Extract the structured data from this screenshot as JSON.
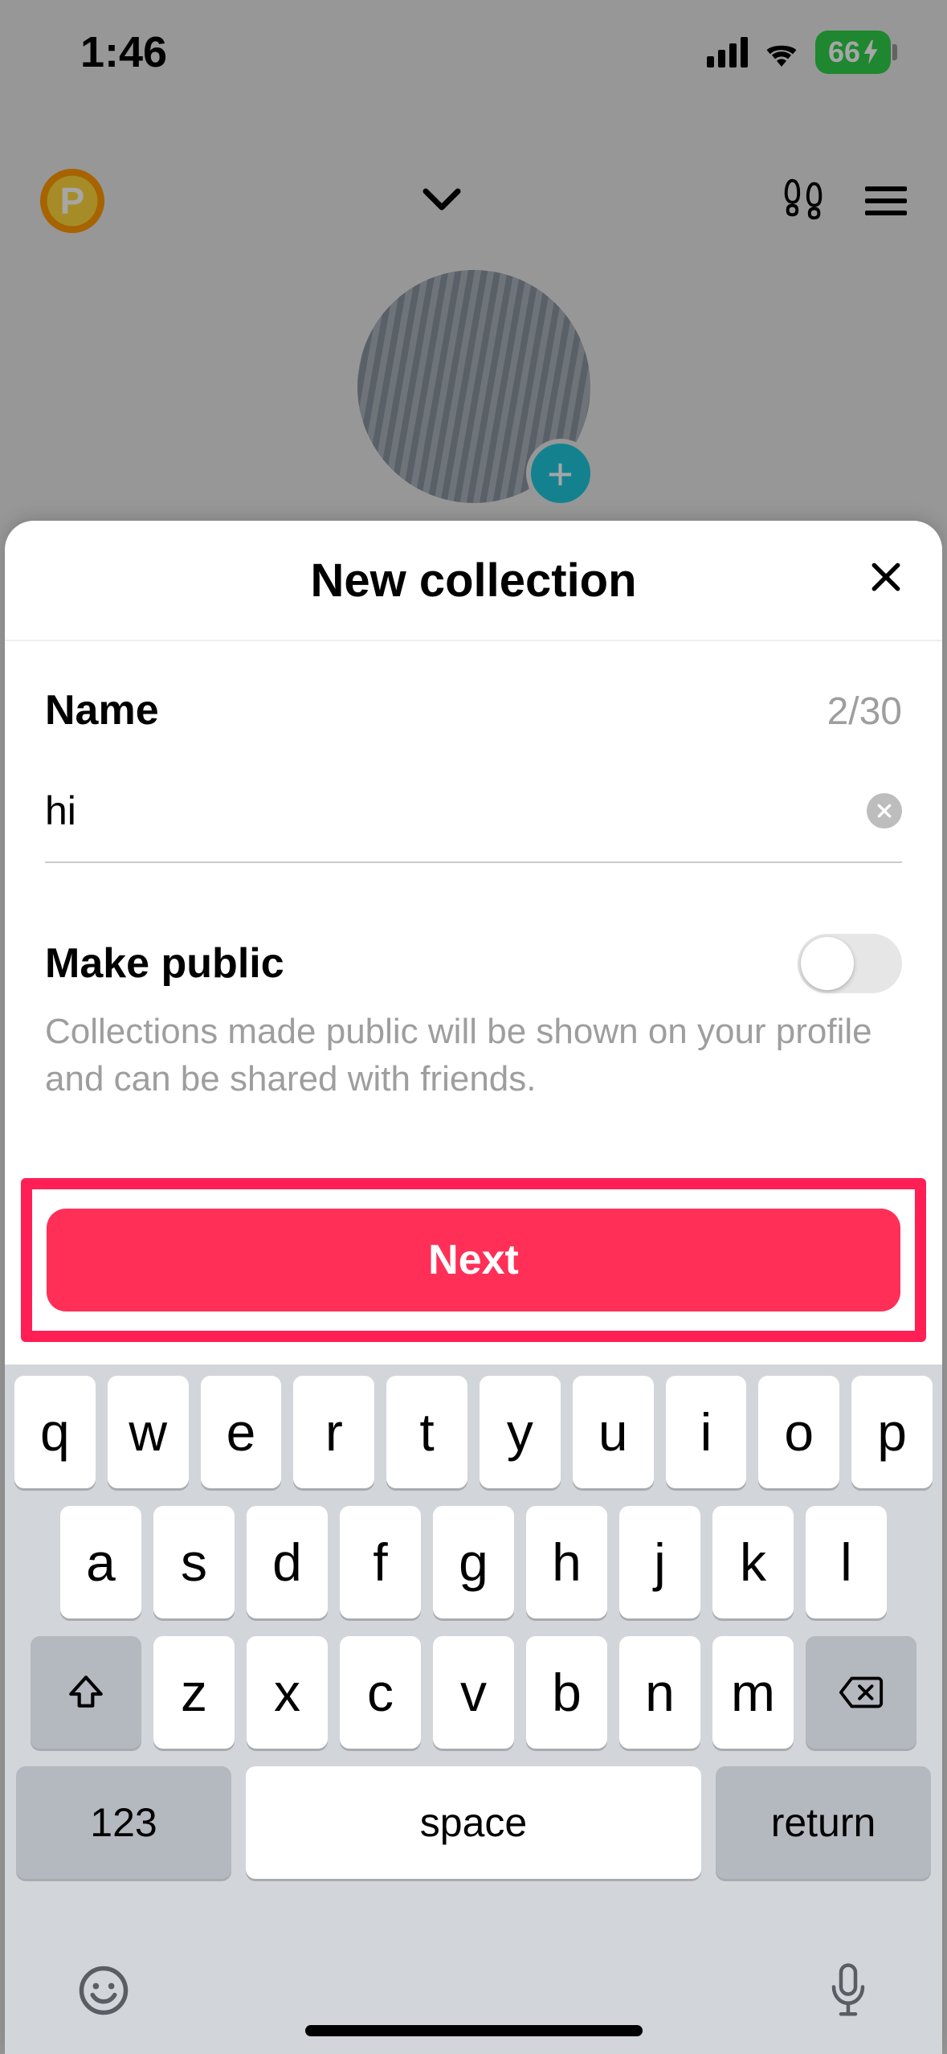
{
  "status": {
    "time": "1:46",
    "battery": "66"
  },
  "header": {
    "badge_letter": "P"
  },
  "sheet": {
    "title": "New collection",
    "name_label": "Name",
    "char_count": "2/30",
    "input_value": "hi",
    "public_label": "Make public",
    "public_desc": "Collections made public will be shown on your profile and can be shared with friends.",
    "next_label": "Next"
  },
  "keyboard": {
    "row1": [
      "q",
      "w",
      "e",
      "r",
      "t",
      "y",
      "u",
      "i",
      "o",
      "p"
    ],
    "row2": [
      "a",
      "s",
      "d",
      "f",
      "g",
      "h",
      "j",
      "k",
      "l"
    ],
    "row3": [
      "z",
      "x",
      "c",
      "v",
      "b",
      "n",
      "m"
    ],
    "k123": "123",
    "space": "space",
    "return": "return"
  }
}
